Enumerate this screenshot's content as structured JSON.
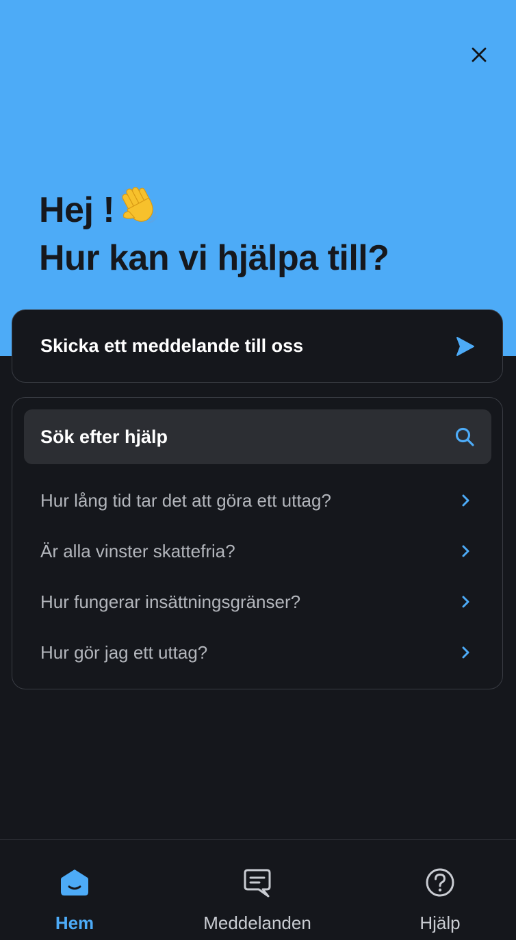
{
  "header": {
    "greeting_line1": "Hej !",
    "greeting_line2": "Hur kan vi hjälpa till?",
    "greeting_icon": "waving-hand-icon",
    "close_icon": "close-icon"
  },
  "send_message": {
    "label": "Skicka ett meddelande till oss",
    "icon": "send-icon"
  },
  "help": {
    "search_label": "Sök efter hjälp",
    "search_icon": "search-icon",
    "faq": [
      {
        "question": "Hur lång tid tar det att göra ett uttag?"
      },
      {
        "question": "Är alla vinster skattefria?"
      },
      {
        "question": "Hur fungerar insättningsgränser?"
      },
      {
        "question": "Hur gör jag ett uttag?"
      }
    ]
  },
  "nav": {
    "tabs": [
      {
        "label": "Hem",
        "icon": "home-icon",
        "active": true
      },
      {
        "label": "Meddelanden",
        "icon": "message-icon",
        "active": false
      },
      {
        "label": "Hjälp",
        "icon": "help-icon",
        "active": false
      }
    ]
  },
  "colors": {
    "accent": "#4dabf7",
    "background": "#15171c",
    "card_border": "#3a3d44",
    "search_bg": "#2c2e33",
    "heading_text": "#16181d"
  }
}
